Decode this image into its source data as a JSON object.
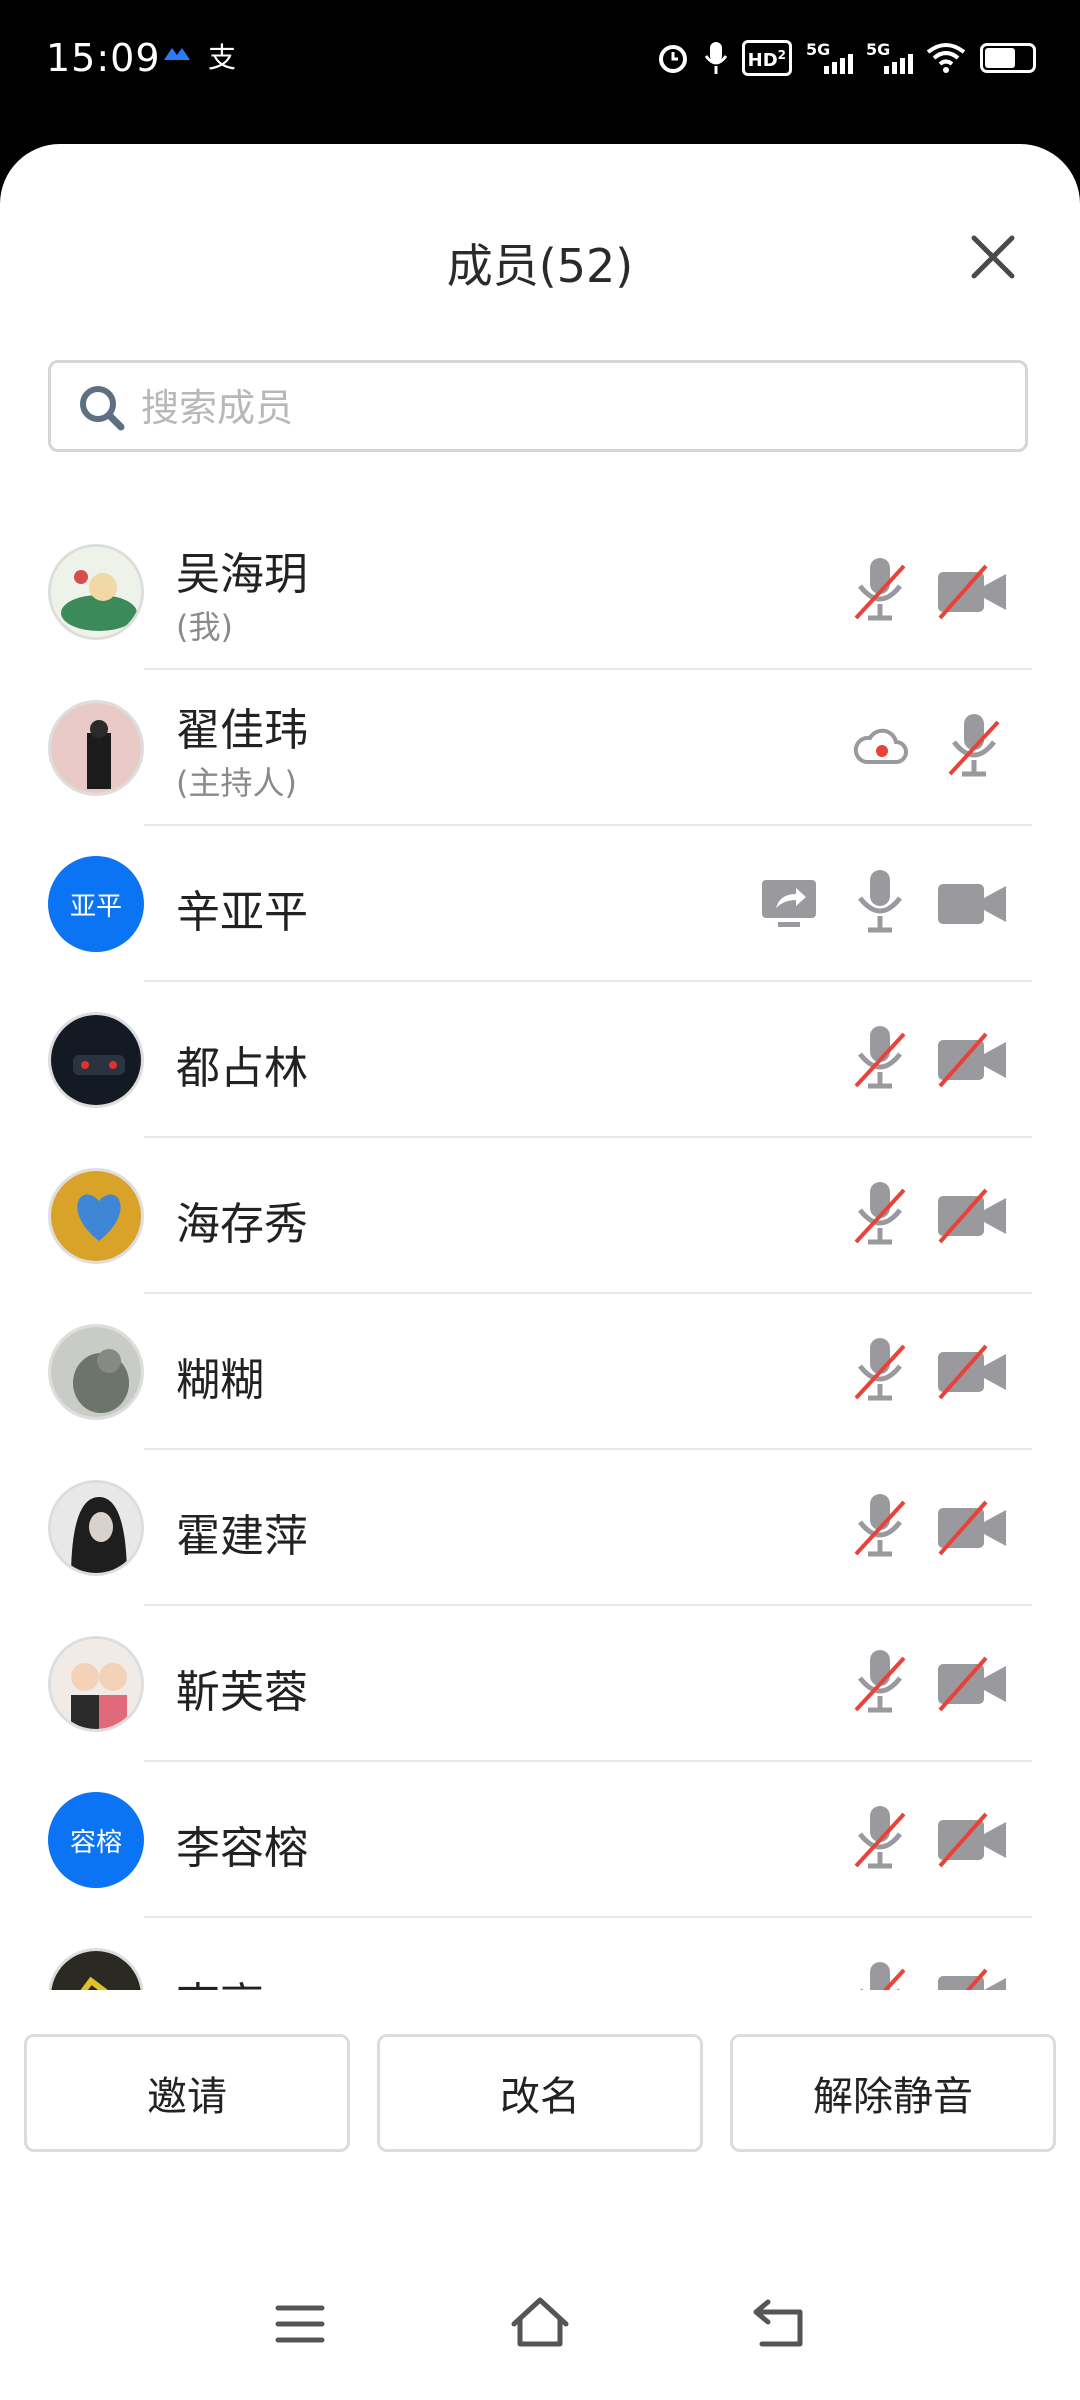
{
  "status_bar": {
    "time": "15:09",
    "app_icons": [
      "meeting-app-icon",
      "alipay-icon"
    ],
    "right_icons": [
      "alarm-icon",
      "mic-icon",
      "hd-volte-icon",
      "5g-signal-icon",
      "5g-signal-icon",
      "wifi-icon",
      "battery-icon"
    ],
    "hd_label": "HD",
    "hd_sub": "2",
    "signal_label": "5G"
  },
  "header": {
    "title": "成员(52)",
    "close_icon": "close-icon"
  },
  "search": {
    "placeholder": "搜索成员",
    "value": ""
  },
  "members": [
    {
      "name": "吴海玥",
      "tag": "(我)",
      "avatar": "photo",
      "mic_muted": true,
      "cam_off": true
    },
    {
      "name": "翟佳玮",
      "tag": "(主持人)",
      "avatar": "photo",
      "recording": true,
      "mic_muted": true
    },
    {
      "name": "辛亚平",
      "tag": "",
      "avatar_initials": "亚平",
      "sharing": true,
      "mic_muted": false,
      "cam_off": false
    },
    {
      "name": "都占林",
      "tag": "",
      "avatar": "photo",
      "mic_muted": true,
      "cam_off": true
    },
    {
      "name": "海存秀",
      "tag": "",
      "avatar": "photo",
      "mic_muted": true,
      "cam_off": true
    },
    {
      "name": "糊糊",
      "tag": "",
      "avatar": "photo",
      "mic_muted": true,
      "cam_off": true
    },
    {
      "name": "霍建萍",
      "tag": "",
      "avatar": "photo",
      "mic_muted": true,
      "cam_off": true
    },
    {
      "name": "靳芙蓉",
      "tag": "",
      "avatar": "photo",
      "mic_muted": true,
      "cam_off": true
    },
    {
      "name": "李容榕",
      "tag": "",
      "avatar_initials": "容榕",
      "mic_muted": true,
      "cam_off": true
    },
    {
      "name": "李高",
      "tag": "",
      "avatar": "photo",
      "mic_muted": true,
      "cam_off": true
    }
  ],
  "footer": {
    "invite_label": "邀请",
    "rename_label": "改名",
    "unmute_label": "解除静音"
  },
  "nav_bar": [
    "menu-icon",
    "home-icon",
    "back-icon"
  ],
  "colors": {
    "accent": "#0a74f5",
    "muted_red": "#e8433a",
    "icon_gray": "#8e8e93"
  }
}
